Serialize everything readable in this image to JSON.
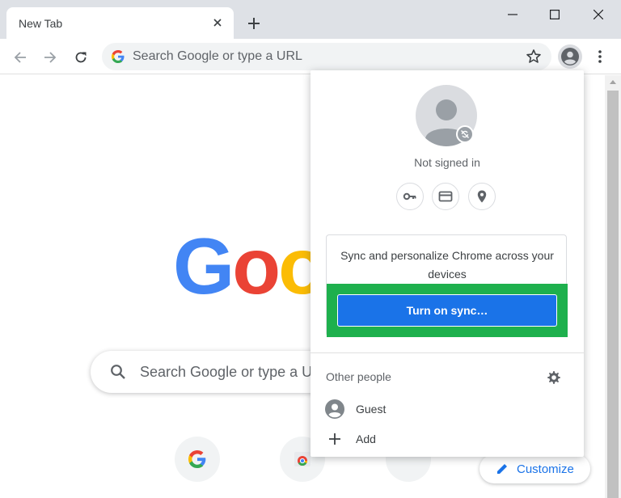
{
  "tab": {
    "title": "New Tab"
  },
  "toolbar": {
    "omnibox_placeholder": "Search Google or type a URL"
  },
  "page": {
    "search_placeholder": "Search Google or type a URL",
    "customize_label": "Customize",
    "logo_letters": [
      "G",
      "o",
      "o"
    ],
    "logo_colors": [
      "#4285f4",
      "#ea4335",
      "#fbbc05"
    ]
  },
  "profile_menu": {
    "status": "Not signed in",
    "sync_promo": "Sync and personalize Chrome across your devices",
    "sync_button": "Turn on sync…",
    "other_people_title": "Other people",
    "people": [
      {
        "label": "Guest",
        "icon": "person-icon"
      },
      {
        "label": "Add",
        "icon": "plus-icon"
      }
    ]
  },
  "colors": {
    "accent": "#1a73e8",
    "highlight": "#1eb04d"
  }
}
